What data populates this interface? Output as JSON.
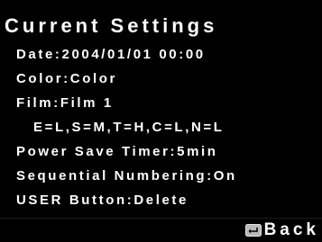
{
  "screen": {
    "title": "Current Settings",
    "items": [
      "Date:2004/01/01 00:00",
      "Color:Color",
      "Film:Film 1",
      "E=L,S=M,T=H,C=L,N=L",
      "Power Save Timer:5min",
      "Sequential Numbering:On",
      "USER Button:Delete"
    ]
  },
  "footer": {
    "back_label": "Back",
    "back_icon": "return-button-icon"
  },
  "colors": {
    "background": "#000000",
    "text": "#ffffff",
    "icon": "#b8b8b8"
  }
}
